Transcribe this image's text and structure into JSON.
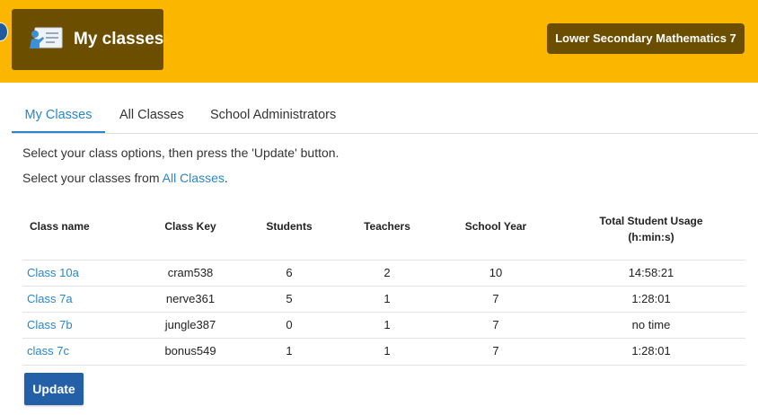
{
  "header": {
    "title": "My classes",
    "course": "Lower Secondary Mathematics 7",
    "icon": "presentation-board-icon",
    "colors": {
      "bar": "#fbb600",
      "box": "#6b4e00",
      "accent": "#2a86c9",
      "button": "#2460a7"
    }
  },
  "tabs": [
    {
      "label": "My Classes",
      "active": true
    },
    {
      "label": "All Classes",
      "active": false
    },
    {
      "label": "School Administrators",
      "active": false
    }
  ],
  "instructions": {
    "line1": "Select your class options, then press the 'Update' button.",
    "line2_prefix": "Select your classes from ",
    "line2_link": "All Classes",
    "line2_suffix": "."
  },
  "table": {
    "headers": {
      "class_name": "Class name",
      "class_key": "Class Key",
      "students": "Students",
      "teachers": "Teachers",
      "school_year": "School Year",
      "usage_line1": "Total Student Usage",
      "usage_line2": "(h:min:s)"
    },
    "rows": [
      {
        "name": "Class 10a",
        "key": "cram538",
        "students": "6",
        "teachers": "2",
        "year": "10",
        "usage": "14:58:21"
      },
      {
        "name": "Class 7a",
        "key": "nerve361",
        "students": "5",
        "teachers": "1",
        "year": "7",
        "usage": "1:28:01"
      },
      {
        "name": "Class 7b",
        "key": "jungle387",
        "students": "0",
        "teachers": "1",
        "year": "7",
        "usage": "no time"
      },
      {
        "name": "class 7c",
        "key": "bonus549",
        "students": "1",
        "teachers": "1",
        "year": "7",
        "usage": "1:28:01"
      }
    ]
  },
  "buttons": {
    "update": "Update"
  }
}
